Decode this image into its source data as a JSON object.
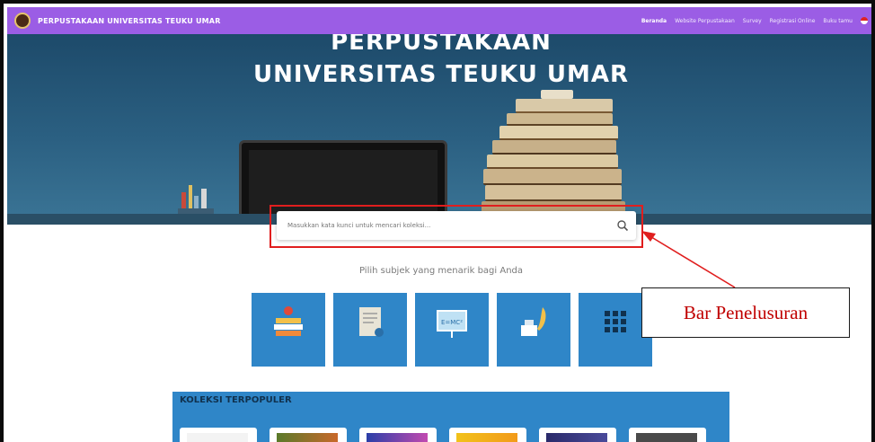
{
  "header": {
    "brand": "PERPUSTAKAAN UNIVERSITAS TEUKU UMAR",
    "nav": [
      {
        "label": "Beranda",
        "active": true
      },
      {
        "label": "Website Perpustakaan",
        "active": false
      },
      {
        "label": "Survey",
        "active": false
      },
      {
        "label": "Registrasi Online",
        "active": false
      },
      {
        "label": "Buku tamu",
        "active": false
      }
    ]
  },
  "hero": {
    "title_line1": "PERPUSTAKAAN",
    "title_line2": "UNIVERSITAS TEUKU UMAR"
  },
  "search": {
    "placeholder": "Masukkan kata kunci untuk mencari koleksi..."
  },
  "subjects": {
    "heading": "Pilih subjek yang menarik bagi Anda",
    "items": [
      {
        "icon": "books-icon"
      },
      {
        "icon": "document-icon"
      },
      {
        "icon": "blackboard-icon"
      },
      {
        "icon": "ink-quill-icon"
      },
      {
        "icon": "grid-icon"
      }
    ]
  },
  "popular": {
    "title": "KOLEKSI TERPOPULER"
  },
  "annotation": {
    "label": "Bar Penelusuran",
    "color": "#c00000"
  },
  "colors": {
    "navbar": "#9b5de5",
    "card": "#2f86c8",
    "highlight": "#e01e1e"
  }
}
